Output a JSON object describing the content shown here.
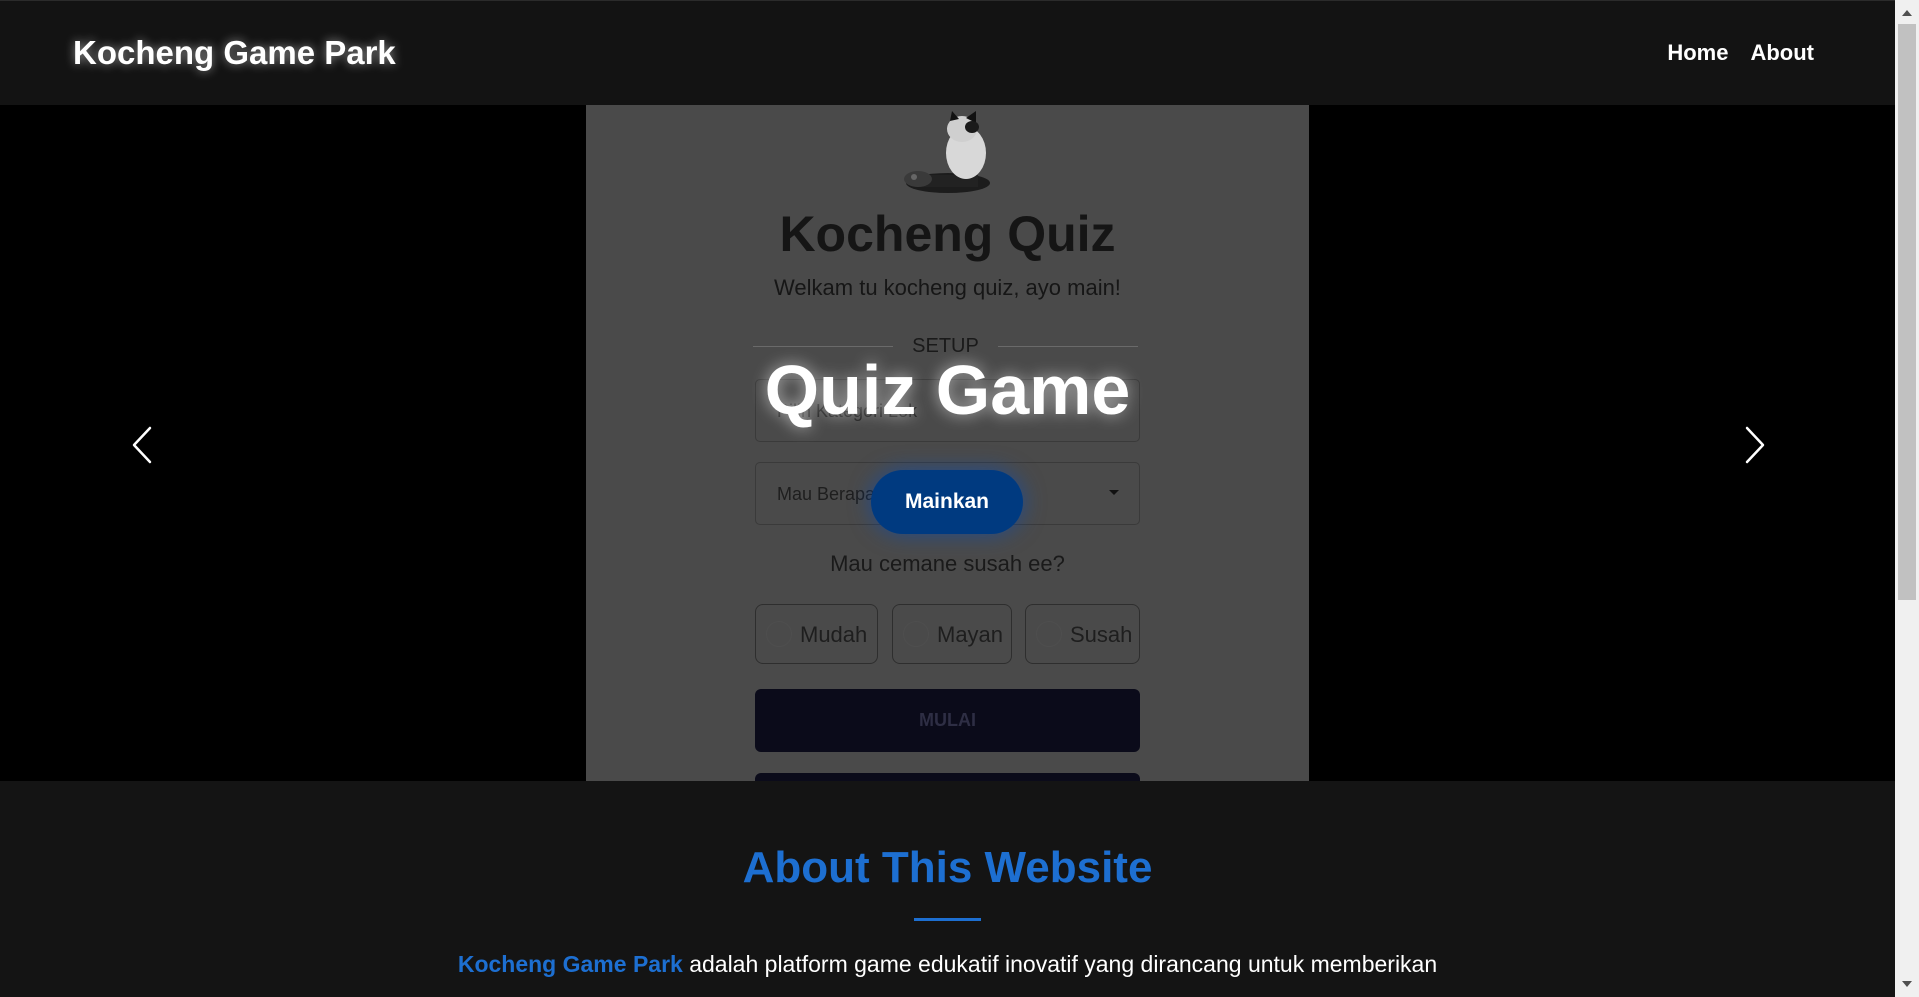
{
  "navbar": {
    "brand": "Kocheng Game Park",
    "links": [
      "Home",
      "About"
    ]
  },
  "carousel": {
    "slide_screenshot": {
      "title": "Kocheng Quiz",
      "subtitle": "Welkam tu kocheng quiz, ayo main!",
      "setup_label": "SETUP",
      "category_placeholder": "Pilih Kategori Lok",
      "count_placeholder": "Mau Berapa",
      "difficulty_question": "Mau cemane susah ee?",
      "options": [
        "Mudah",
        "Mayan",
        "Susah"
      ],
      "start_label": "MULAI"
    },
    "overlay_title": "Quiz Game",
    "play_button": "Mainkan",
    "prev_icon": "chevron-left-icon",
    "next_icon": "chevron-right-icon"
  },
  "about": {
    "heading": "About This Website",
    "brand_highlight": "Kocheng Game Park",
    "text": " adalah platform game edukatif inovatif yang dirancang untuk memberikan"
  },
  "colors": {
    "accent": "#1d6fd1",
    "play_button": "#003a80",
    "navbar_bg": "#131313",
    "page_bg": "#141414"
  }
}
